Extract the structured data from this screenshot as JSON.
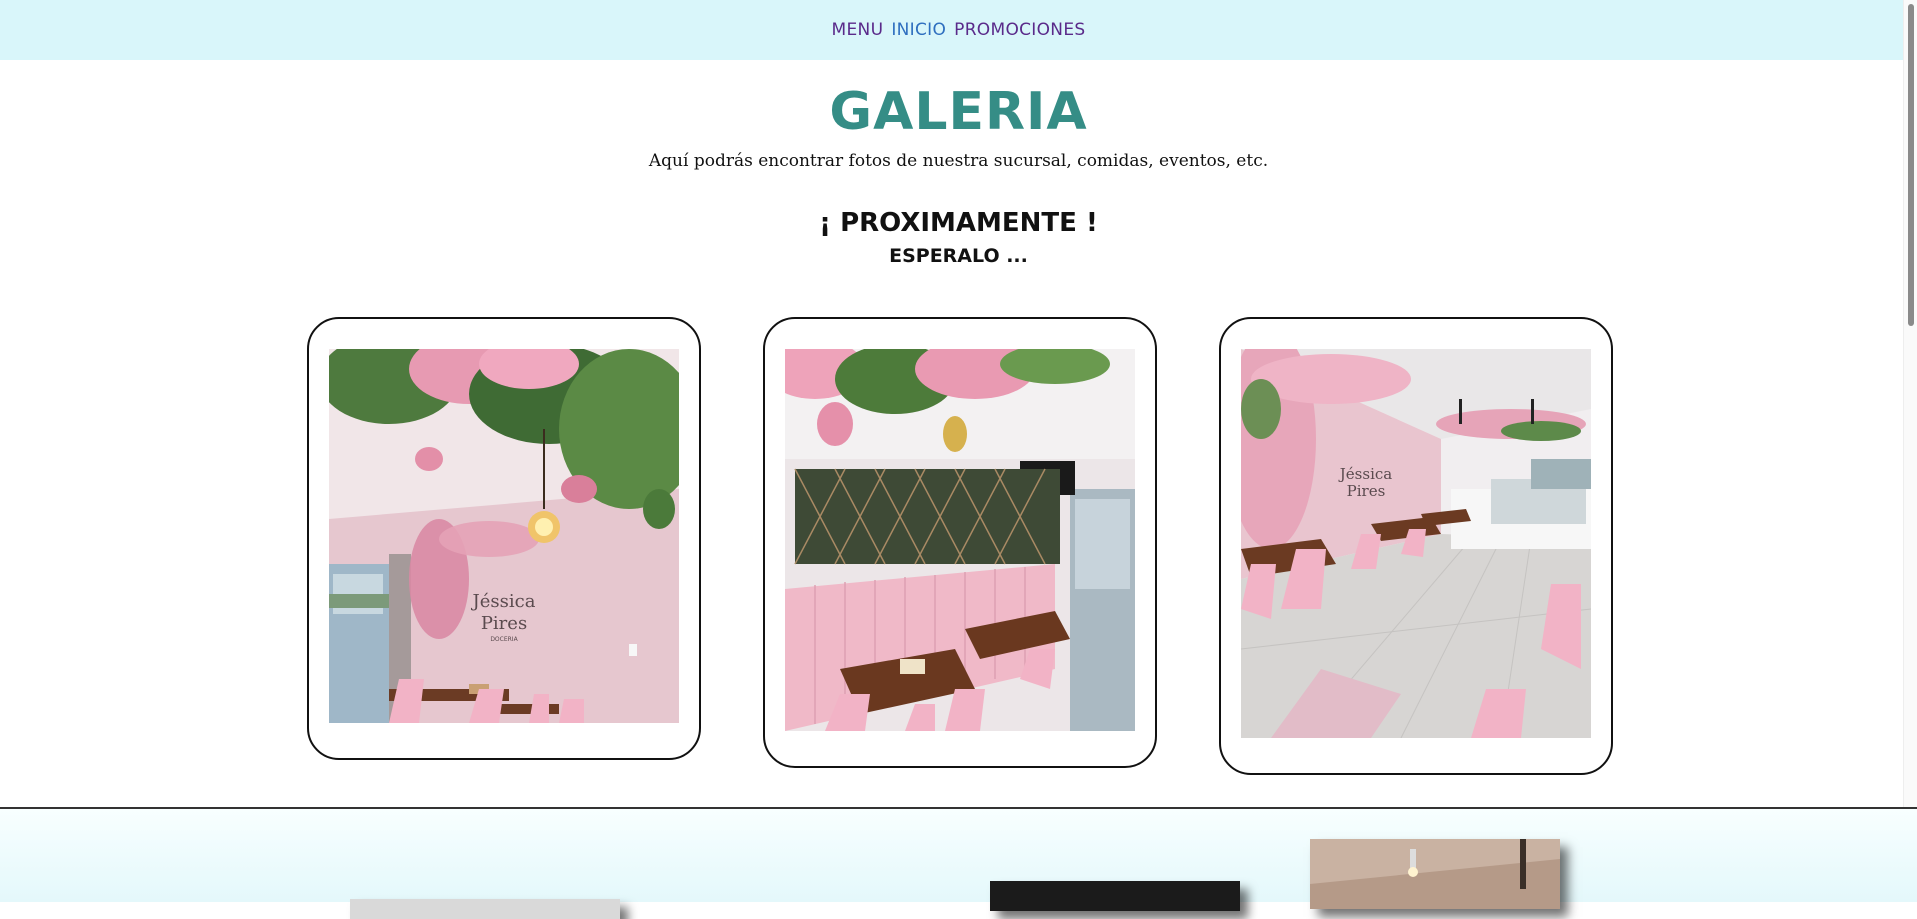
{
  "nav": {
    "items": [
      {
        "label": "MENU"
      },
      {
        "label": "INICIO"
      },
      {
        "label": "PROMOCIONES"
      }
    ]
  },
  "gallery": {
    "title": "GALERIA",
    "subtitle": "Aquí podrás encontrar fotos de nuestra sucursal, comidas, eventos, etc.",
    "coming_soon": "¡ PROXIMAMENTE !",
    "wait": "ESPERALO ...",
    "sign_line1": "Jéssica",
    "sign_line2": "Pires",
    "sign_line3": "DOCERIA"
  },
  "colors": {
    "nav_bg": "#d9f6fa",
    "title": "#358d86",
    "nav_link": "#5a2a8a",
    "nav_active": "#2f6fbf",
    "wall_pink": "#e9c9d0",
    "chair_pink": "#f2b3c6"
  }
}
